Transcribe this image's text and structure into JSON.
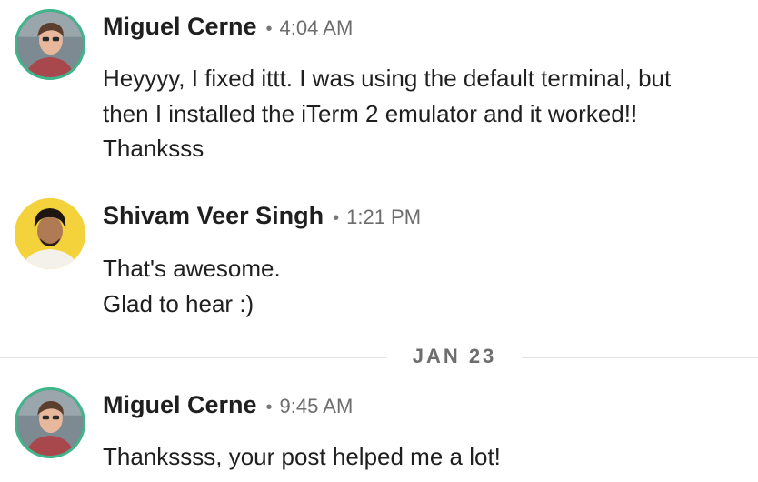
{
  "messages": [
    {
      "author": "Miguel Cerne",
      "separator": "•",
      "time": "4:04 AM",
      "lines": [
        "Heyyyy, I fixed ittt. I was using the default terminal, but",
        "then I installed the iTerm 2 emulator and it worked!!",
        "Thanksss"
      ]
    },
    {
      "author": "Shivam Veer Singh",
      "separator": "•",
      "time": "1:21 PM",
      "lines": [
        "That's awesome.",
        "Glad to hear :)"
      ]
    },
    {
      "author": "Miguel Cerne",
      "separator": "•",
      "time": "9:45 AM",
      "lines": [
        "Thankssss, your post helped me a lot!"
      ]
    }
  ],
  "date_divider": {
    "label": "JAN 23"
  },
  "colors": {
    "avatar_ring_miguel": "#3fb58a",
    "avatar_bg_shivam": "#f3d23c",
    "text": "#1f1f1f",
    "muted": "#6d6d6d",
    "divider": "#e3e3e3"
  },
  "icons": {
    "avatar_miguel": "user-photo-avatar",
    "avatar_shivam": "user-photo-avatar"
  }
}
